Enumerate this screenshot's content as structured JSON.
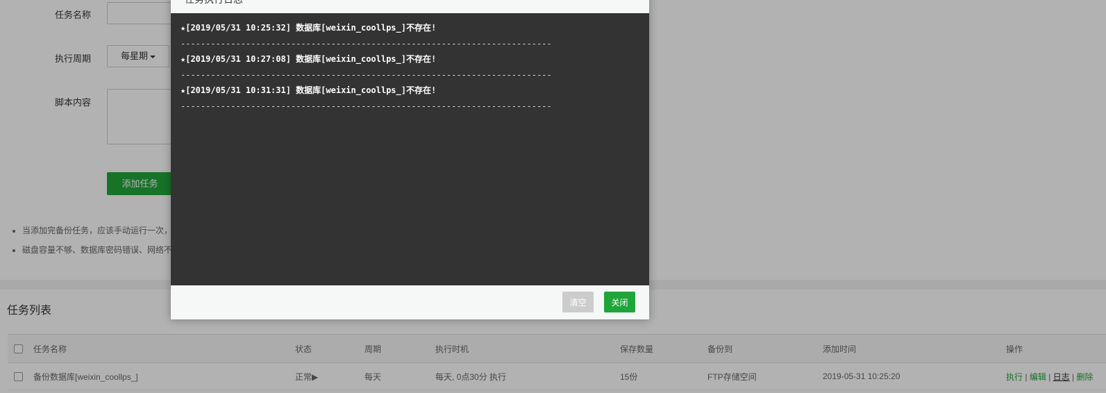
{
  "form": {
    "task_name_label": "任务名称",
    "period_label": "执行周期",
    "period_value": "每星期",
    "script_label": "脚本内容",
    "add_button": "添加任务"
  },
  "tips": [
    "当添加完备份任务，应该手动运行一次，",
    "磁盘容量不够、数据库密码错误、网络不"
  ],
  "task_list": {
    "title": "任务列表",
    "columns": [
      "任务名称",
      "状态",
      "周期",
      "执行时机",
      "保存数量",
      "备份到",
      "添加时间",
      "操作"
    ],
    "rows": [
      {
        "name": "备份数据库[weixin_coollps_]",
        "status": "正常▶",
        "period": "每天",
        "timing": "每天, 0点30分 执行",
        "keep": "15份",
        "backup_to": "FTP存储空间",
        "added": "2019-05-31 10:25:20",
        "ops": [
          "执行",
          "编辑",
          "日志",
          "删除"
        ]
      }
    ]
  },
  "dialog": {
    "title": "任务执行日志",
    "log": [
      "★[2019/05/31 10:25:32] 数据库[weixin_coollps_]不存在!",
      "--------------------------------------------------------------------------",
      "★[2019/05/31 10:27:08] 数据库[weixin_coollps_]不存在!",
      "--------------------------------------------------------------------------",
      "★[2019/05/31 10:31:31] 数据库[weixin_coollps_]不存在!",
      "--------------------------------------------------------------------------"
    ],
    "clear_button": "清空",
    "close_button": "关闭"
  },
  "colors": {
    "accent": "#20a53a",
    "log_bg": "#333333",
    "disabled": "#cccccc"
  }
}
